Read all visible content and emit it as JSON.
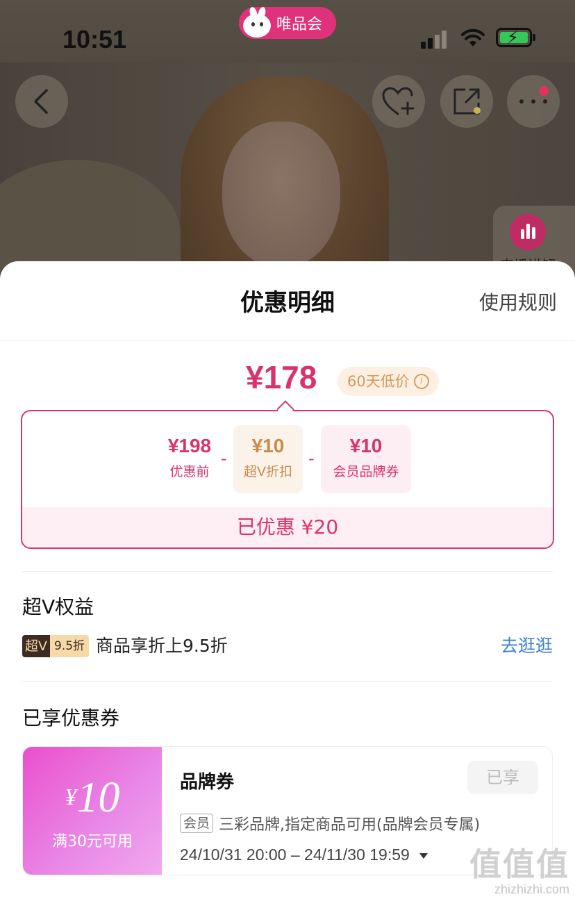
{
  "status_bar": {
    "time": "10:51",
    "app_pill_label": "唯品会",
    "battery_color": "#35c759"
  },
  "top_actions": {
    "back_icon": "back-chevron-icon",
    "favorite_icon": "heart-plus-icon",
    "share_icon": "share-icon",
    "more_icon": "more-dots-icon"
  },
  "live": {
    "label": "直播讲解"
  },
  "sheet": {
    "title": "优惠明细",
    "rules_link": "使用规则",
    "final_price": "¥178",
    "low_price_badge": "60天低价",
    "breakdown": {
      "original_amount": "¥198",
      "original_label": "优惠前",
      "minus": "-",
      "svip_amount": "¥10",
      "svip_label": "超V折扣",
      "coupon_amount": "¥10",
      "coupon_label": "会员品牌券",
      "saved_label": "已优惠",
      "saved_amount": "¥20"
    },
    "svip_section": {
      "title": "超V权益",
      "tag_part1": "超V",
      "tag_part2": "9.5折",
      "description": "商品享折上9.5折",
      "go_link": "去逛逛"
    },
    "coupon_section": {
      "title": "已享优惠券",
      "coupon": {
        "yen": "¥",
        "amount": "10",
        "condition": "满30元可用",
        "name": "品牌券",
        "status_button": "已享",
        "member_tag": "会员",
        "description": "三彩品牌,指定商品可用(品牌会员专属)",
        "validity": "24/10/31 20:00 – 24/11/30 19:59"
      }
    }
  },
  "watermark": {
    "big": "值值值",
    "small": "zhizhizhi.com"
  },
  "colors": {
    "accent": "#d9336e",
    "gold": "#c88b4a",
    "link": "#3b7fd1"
  }
}
